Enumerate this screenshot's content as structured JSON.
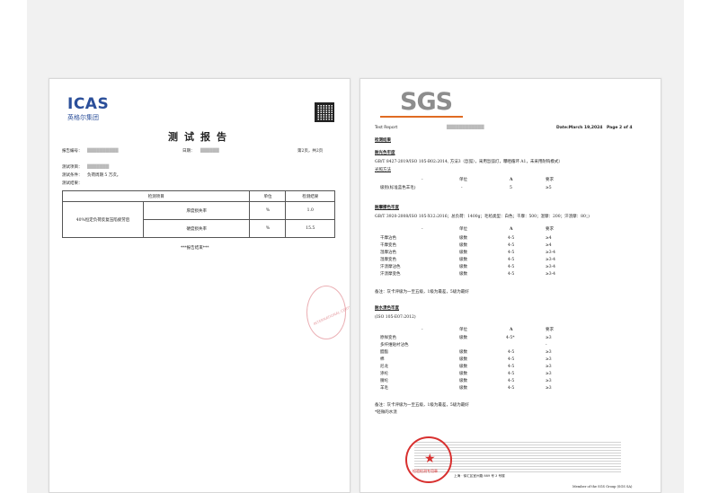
{
  "left": {
    "logo_text": "ICAS",
    "logo_sub": "英格尔集团",
    "title": "测试报告",
    "report_no_label": "报告编号：",
    "report_no_value": "██████████",
    "date_label": "日期：",
    "date_value": "██████",
    "page_info": "第2页，共2页",
    "item_label": "测试项目：",
    "item_value": "███████",
    "condition_label": "测试条件：",
    "condition_value": "负荷周期 5 万次。",
    "result_label": "测试结果：",
    "table": {
      "headers": [
        "检测项目",
        "单位",
        "检测结果"
      ],
      "group_label": "40%恒定负荷反复压陷疲劳后",
      "rows": [
        {
          "item": "厚度损失率",
          "unit": "%",
          "result": "1.0"
        },
        {
          "item": "硬度损失率",
          "unit": "%",
          "result": "15.5"
        }
      ]
    },
    "end_note": "***报告结束***",
    "stamp_text": "INTERNATIONAL CERTIFICATION"
  },
  "right": {
    "logo_text": "SGS",
    "header_label": "Test Report",
    "header_no": "████████████",
    "header_date": "Date:March 19,2024",
    "header_page": "Page 2 of 4",
    "result_title": "检测结果",
    "s1_title": "耐光色牢度",
    "s1_method": "GB/T 8427-2019/ISO 105-B02:2014, 方法3（氙弧），采用氙弧灯，曝晒循环 A1，未采用耐钩模式）",
    "s1_sub": "光照方法",
    "s1_cols": [
      "-",
      "单位",
      "A",
      "要求"
    ],
    "s1_rows": [
      {
        "item": "级别(标准蓝色羊毛)",
        "unit": "-",
        "a": "5",
        "req": "≥5"
      }
    ],
    "s2_title": "耐摩擦色牢度",
    "s2_method": "GB/T 3920-2008/ISO 105-X12:2016；总负荷：1400g；毛毡类型：白色；干摩：500；湿摩：200；汗渍摩：80；)",
    "s2_cols": [
      "-",
      "单位",
      "A",
      "要求"
    ],
    "s2_rows": [
      {
        "item": "干摩沾色",
        "unit": "级数",
        "a": "4-5",
        "req": "≥4"
      },
      {
        "item": "干摩变色",
        "unit": "级数",
        "a": "4-5",
        "req": "≥4"
      },
      {
        "item": "湿摩沾色",
        "unit": "级数",
        "a": "4-5",
        "req": "≥3-4"
      },
      {
        "item": "湿摩变色",
        "unit": "级数",
        "a": "4-5",
        "req": "≥3-4"
      },
      {
        "item": "汗渍摩沾色",
        "unit": "级数",
        "a": "4-5",
        "req": "≥3-4"
      },
      {
        "item": "汗渍摩变色",
        "unit": "级数",
        "a": "4-5",
        "req": "≥3-4"
      }
    ],
    "s2_note": "备注：灰卡评级为一至五级，1级为最差，5级为最好",
    "s3_title": "耐水渍色牢度",
    "s3_method": "(ISO 105-E07:2012)",
    "s3_cols": [
      "-",
      "单位",
      "A",
      "要求"
    ],
    "s3_rows": [
      {
        "item": "原样变色",
        "unit": "级数",
        "a": "4-5*",
        "req": "≥3"
      },
      {
        "item": "多纤维贴衬沾色",
        "unit": "",
        "a": "",
        "req": "-"
      },
      {
        "item": "醋酯",
        "unit": "级数",
        "a": "4-5",
        "req": "≥3"
      },
      {
        "item": "棉",
        "unit": "级数",
        "a": "4-5",
        "req": "≥3"
      },
      {
        "item": "尼龙",
        "unit": "级数",
        "a": "4-5",
        "req": "≥3"
      },
      {
        "item": "涤纶",
        "unit": "级数",
        "a": "4-5",
        "req": "≥3"
      },
      {
        "item": "腈纶",
        "unit": "级数",
        "a": "4-5",
        "req": "≥3"
      },
      {
        "item": "羊毛",
        "unit": "级数",
        "a": "4-5",
        "req": "≥3"
      }
    ],
    "s3_note1": "备注：灰卡评级为一至五级，1级为最差，5级为最好",
    "s3_note2": "*轻微的水渍",
    "footer_addr": "上海 · 徐汇区宜州路 889 号 3 号楼",
    "footer_member": "Member of the SGS Group (SGS SA)",
    "stamp_text": "检验检测专用章"
  },
  "colors": {
    "icas_blue": "#2b4f9a",
    "sgs_gray": "#8d8d8d",
    "sgs_orange": "#e06b22",
    "stamp_red": "#d8302f"
  }
}
